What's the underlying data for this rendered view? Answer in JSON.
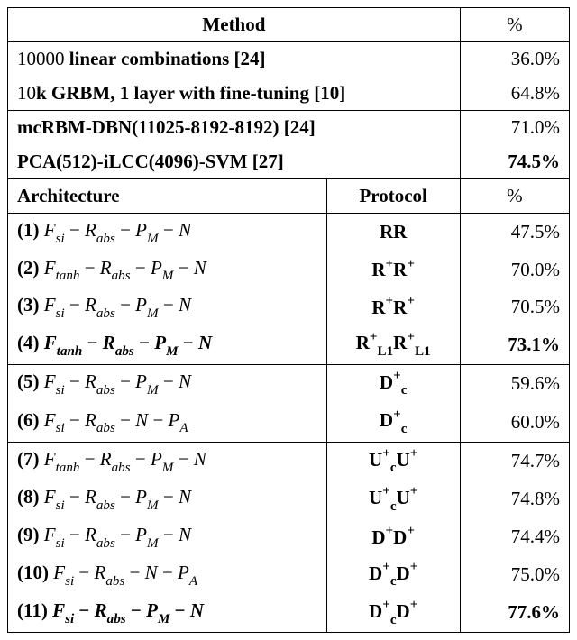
{
  "headers": {
    "method": "Method",
    "percent": "%",
    "architecture": "Architecture",
    "protocol": "Protocol",
    "percent2": "%"
  },
  "top": [
    {
      "label_pre": "10000 ",
      "label_bold": "linear combinations [24]",
      "pct": "36.0%"
    },
    {
      "label_pre": "10",
      "label_bold": "k GRBM, 1 layer with fine-tuning [10]",
      "pct": "64.8%"
    }
  ],
  "mid": [
    {
      "label": "mcRBM-DBN(11025-8192-8192) [24]",
      "pct": "71.0%"
    },
    {
      "label": "PCA(512)-iLCC(4096)-SVM [27]",
      "pct": "74.5%"
    }
  ],
  "rows": [
    {
      "n": "(1)",
      "arch": "F_si − R_abs − P_M − N",
      "prot": "RR",
      "pct": "47.5%",
      "bold": false,
      "prot_bold": true
    },
    {
      "n": "(2)",
      "arch": "F_tanh − R_abs − P_M − N",
      "prot": "R+R+",
      "pct": "70.0%",
      "bold": false,
      "prot_bold": true
    },
    {
      "n": "(3)",
      "arch": "F_si − R_abs − P_M − N",
      "prot": "R+R+",
      "pct": "70.5%",
      "bold": false,
      "prot_bold": true
    },
    {
      "n": "(4)",
      "arch": "F_tanh − R_abs − P_M − N",
      "prot": "R+L1R+L1",
      "pct": "73.1%",
      "bold": true,
      "prot_bold": true
    },
    {
      "n": "(5)",
      "arch": "F_si − R_abs − P_M − N",
      "prot": "D+c",
      "pct": "59.6%",
      "bold": false,
      "prot_bold": true
    },
    {
      "n": "(6)",
      "arch": "F_si − R_abs − N − P_A",
      "prot": "D+c",
      "pct": "60.0%",
      "bold": false,
      "prot_bold": true
    },
    {
      "n": "(7)",
      "arch": "F_tanh − R_abs − P_M − N",
      "prot": "U+cU+",
      "pct": "74.7%",
      "bold": false,
      "prot_bold": true
    },
    {
      "n": "(8)",
      "arch": "F_si − R_abs − P_M − N",
      "prot": "U+cU+",
      "pct": "74.8%",
      "bold": false,
      "prot_bold": true
    },
    {
      "n": "(9)",
      "arch": "F_si − R_abs − P_M − N",
      "prot": "D+D+",
      "pct": "74.4%",
      "bold": false,
      "prot_bold": true
    },
    {
      "n": "(10)",
      "arch": "F_si − R_abs − N − P_A",
      "prot": "D+cD+",
      "pct": "75.0%",
      "bold": false,
      "prot_bold": true
    },
    {
      "n": "(11)",
      "arch": "F_si − R_abs − P_M − N",
      "prot": "D+cD+",
      "pct": "77.6%",
      "bold": true,
      "prot_bold": true
    }
  ],
  "chart_data": {
    "type": "table",
    "title": "Classification accuracy (%) by method / architecture",
    "baselines": [
      {
        "method": "10000 linear combinations [24]",
        "pct": 36.0
      },
      {
        "method": "10k GRBM, 1 layer with fine-tuning [10]",
        "pct": 64.8
      },
      {
        "method": "mcRBM-DBN(11025-8192-8192) [24]",
        "pct": 71.0
      },
      {
        "method": "PCA(512)-iLCC(4096)-SVM [27]",
        "pct": 74.5
      }
    ],
    "experiments": [
      {
        "id": 1,
        "architecture": "F_si - R_abs - P_M - N",
        "protocol": "RR",
        "pct": 47.5
      },
      {
        "id": 2,
        "architecture": "F_tanh - R_abs - P_M - N",
        "protocol": "R+ R+",
        "pct": 70.0
      },
      {
        "id": 3,
        "architecture": "F_si - R_abs - P_M - N",
        "protocol": "R+ R+",
        "pct": 70.5
      },
      {
        "id": 4,
        "architecture": "F_tanh - R_abs - P_M - N",
        "protocol": "R+_L1 R+_L1",
        "pct": 73.1
      },
      {
        "id": 5,
        "architecture": "F_si - R_abs - P_M - N",
        "protocol": "D+_c",
        "pct": 59.6
      },
      {
        "id": 6,
        "architecture": "F_si - R_abs - N - P_A",
        "protocol": "D+_c",
        "pct": 60.0
      },
      {
        "id": 7,
        "architecture": "F_tanh - R_abs - P_M - N",
        "protocol": "U+_c U+",
        "pct": 74.7
      },
      {
        "id": 8,
        "architecture": "F_si - R_abs - P_M - N",
        "protocol": "U+_c U+",
        "pct": 74.8
      },
      {
        "id": 9,
        "architecture": "F_si - R_abs - P_M - N",
        "protocol": "D+ D+",
        "pct": 74.4
      },
      {
        "id": 10,
        "architecture": "F_si - R_abs - N - P_A",
        "protocol": "D+_c D+",
        "pct": 75.0
      },
      {
        "id": 11,
        "architecture": "F_si - R_abs - P_M - N",
        "protocol": "D+_c D+",
        "pct": 77.6
      }
    ]
  }
}
